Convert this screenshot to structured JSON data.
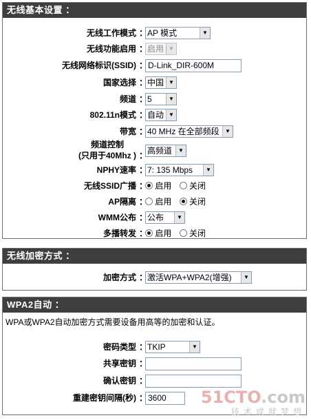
{
  "wireless": {
    "header": "无线基本设置 ：",
    "rows": [
      {
        "label": "无线工作模式",
        "value": "AP 模式"
      },
      {
        "label": "无线功能启用",
        "value": "启用"
      },
      {
        "label": "无线网络标识(SSID)",
        "value": "D-Link_DIR-600M"
      },
      {
        "label": "国家选择",
        "value": "中国"
      },
      {
        "label": "频道",
        "value": "5"
      },
      {
        "label": "802.11n模式",
        "value": "自动"
      },
      {
        "label": "带宽",
        "value": "40 MHz 在全部频段"
      },
      {
        "label": "频道控制",
        "label2": "(只用于40Mhz )",
        "value": "高频道"
      },
      {
        "label": "NPHY速率",
        "value": "7: 135 Mbps"
      },
      {
        "label": "无线SSID广播",
        "opt1": "启用",
        "opt2": "关闭",
        "selected": "启用"
      },
      {
        "label": "AP隔离",
        "opt1": "启用",
        "opt2": "关闭",
        "selected": "关闭"
      },
      {
        "label": "WMM公布",
        "value": "公布"
      },
      {
        "label": "多播转发",
        "opt1": "启用",
        "opt2": "关闭",
        "selected": "启用"
      }
    ],
    "colon": "："
  },
  "encryption": {
    "header": "无线加密方式 ：",
    "label": "加密方式",
    "value": "激活WPA+WPA2(增强)"
  },
  "wpa2": {
    "header": "WPA2自动 ：",
    "note": "WPA或WPA2自动加密方式需要设备用高等的加密和认证。",
    "cipher_label": "密码类型",
    "cipher_value": "TKIP",
    "psk_label": "共享密钥",
    "psk_value": "",
    "confirm_label": "确认密钥",
    "confirm_value": "",
    "rekey_label": "重建密钥间隔(秒)",
    "rekey_value": "3600"
  },
  "watermark": {
    "brand_a": "51CTO",
    "brand_b": ".com",
    "slogan": "技术成就梦想"
  },
  "colors": {
    "header_bg": "#3e3e3e",
    "border": "#7f9db9"
  }
}
